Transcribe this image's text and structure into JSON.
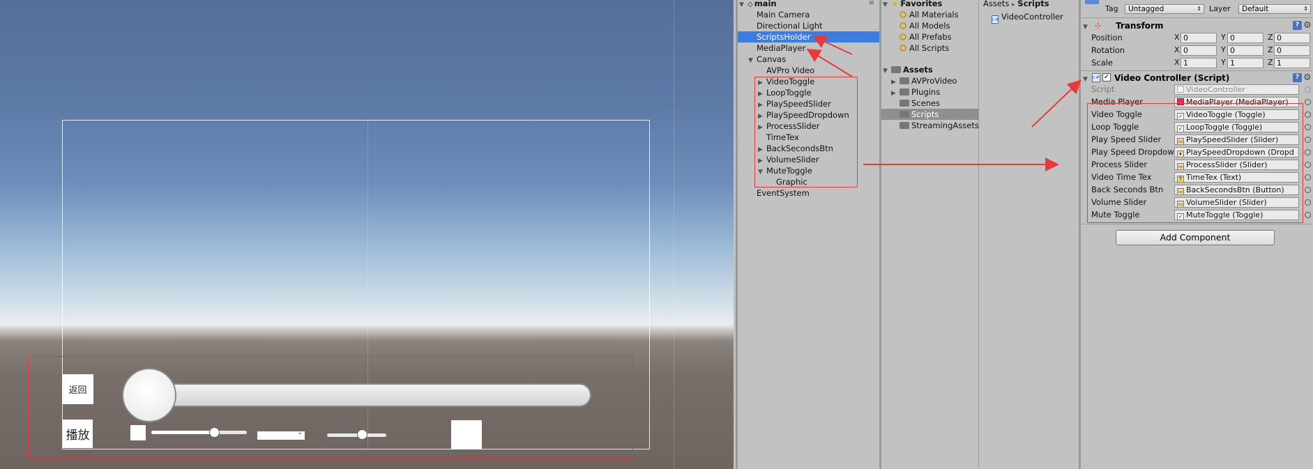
{
  "scene": {
    "back_label": "返回",
    "play_label": "播放",
    "dropdown_arrow": "⌄"
  },
  "hierarchy": {
    "root": "main",
    "items": [
      {
        "label": "Main Camera",
        "indent": 0,
        "arrow": ""
      },
      {
        "label": "Directional Light",
        "indent": 0,
        "arrow": ""
      },
      {
        "label": "ScriptsHolder",
        "indent": 0,
        "arrow": "",
        "selected": true
      },
      {
        "label": "MediaPlayer",
        "indent": 0,
        "arrow": ""
      },
      {
        "label": "Canvas",
        "indent": 0,
        "arrow": "▼"
      },
      {
        "label": "AVPro Video",
        "indent": 1,
        "arrow": ""
      },
      {
        "label": "VideoToggle",
        "indent": 1,
        "arrow": "▶"
      },
      {
        "label": "LoopToggle",
        "indent": 1,
        "arrow": "▶"
      },
      {
        "label": "PlaySpeedSlider",
        "indent": 1,
        "arrow": "▶"
      },
      {
        "label": "PlaySpeedDropdown",
        "indent": 1,
        "arrow": "▶"
      },
      {
        "label": "ProcessSlider",
        "indent": 1,
        "arrow": "▶"
      },
      {
        "label": "TimeTex",
        "indent": 1,
        "arrow": ""
      },
      {
        "label": "BackSecondsBtn",
        "indent": 1,
        "arrow": "▶"
      },
      {
        "label": "VolumeSlider",
        "indent": 1,
        "arrow": "▶"
      },
      {
        "label": "MuteToggle",
        "indent": 1,
        "arrow": "▼"
      },
      {
        "label": "Graphic",
        "indent": 2,
        "arrow": ""
      },
      {
        "label": "EventSystem",
        "indent": 0,
        "arrow": ""
      }
    ]
  },
  "project": {
    "favorites_label": "Favorites",
    "favorites": [
      "All Materials",
      "All Models",
      "All Prefabs",
      "All Scripts"
    ],
    "assets_label": "Assets",
    "assets": [
      "AVProVideo",
      "Plugins",
      "Scenes",
      "Scripts",
      "StreamingAssets"
    ],
    "breadcrumb_root": "Assets",
    "breadcrumb_sep": "▸",
    "breadcrumb_current": "Scripts",
    "files": [
      "VideoController"
    ]
  },
  "inspector": {
    "tag_label": "Tag",
    "tag_value": "Untagged",
    "layer_label": "Layer",
    "layer_value": "Default",
    "transform_title": "Transform",
    "transform_rows": [
      {
        "label": "Position",
        "x": "0",
        "y": "0",
        "z": "0"
      },
      {
        "label": "Rotation",
        "x": "0",
        "y": "0",
        "z": "0"
      },
      {
        "label": "Scale",
        "x": "1",
        "y": "1",
        "z": "1"
      }
    ],
    "axis_x": "X",
    "axis_y": "Y",
    "axis_z": "Z",
    "component_title": "Video Controller (Script)",
    "script_label": "Script",
    "script_value": "VideoController",
    "fields": [
      {
        "label": "Media Player",
        "value": "MediaPlayer (MediaPlayer)",
        "icon": "media-icon"
      },
      {
        "label": "Video Toggle",
        "value": "VideoToggle (Toggle)",
        "icon": "toggle-icon"
      },
      {
        "label": "Loop Toggle",
        "value": "LoopToggle (Toggle)",
        "icon": "toggle-icon"
      },
      {
        "label": "Play Speed Slider",
        "value": "PlaySpeedSlider (Slider)",
        "icon": "slider-icon"
      },
      {
        "label": "Play Speed Dropdow",
        "value": "PlaySpeedDropdown (Dropd",
        "icon": "dropdown-icon"
      },
      {
        "label": "Process Slider",
        "value": "ProcessSlider (Slider)",
        "icon": "slider-icon"
      },
      {
        "label": "Video Time Tex",
        "value": "TimeTex (Text)",
        "icon": "text-icon"
      },
      {
        "label": "Back Seconds Btn",
        "value": "BackSecondsBtn (Button)",
        "icon": "button-icon"
      },
      {
        "label": "Volume Slider",
        "value": "VolumeSlider (Slider)",
        "icon": "slider-icon"
      },
      {
        "label": "Mute Toggle",
        "value": "MuteToggle (Toggle)",
        "icon": "toggle-icon"
      }
    ],
    "add_component": "Add Component",
    "help_glyph": "?",
    "gear_glyph": "⚙"
  },
  "colors": {
    "selection": "#3e7de0",
    "annotation_red": "#e53b3b",
    "panel_bg": "#c2c2c2"
  }
}
